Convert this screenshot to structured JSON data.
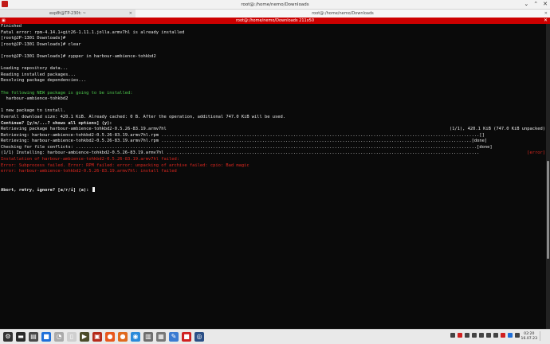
{
  "window": {
    "title": "root@:/home/nemo/Downloads"
  },
  "tabs": [
    {
      "label": "exp8t@TP-230t: ~"
    },
    {
      "label": "root@:/home/nemo/Downloads"
    }
  ],
  "terminal_title": "root@:/home/nemo/Downloads 211x50",
  "lines": [
    {
      "text": "Finished",
      "cls": ""
    },
    {
      "text": "Fatal error: rpm-4.14.1+git26-1.11.1.jolla.armv7hl is already installed",
      "cls": ""
    },
    {
      "text": "[root@JP-1301 Downloads]# ",
      "cls": ""
    },
    {
      "text": "[root@JP-1301 Downloads]# clear",
      "cls": ""
    },
    {
      "text": "",
      "cls": ""
    },
    {
      "text": "[root@JP-1301 Downloads]# zypper in harbour-ambience-tohkbd2",
      "cls": ""
    },
    {
      "text": "",
      "cls": ""
    },
    {
      "text": "Loading repository data...",
      "cls": ""
    },
    {
      "text": "Reading installed packages...",
      "cls": ""
    },
    {
      "text": "Resolving package dependencies...",
      "cls": ""
    },
    {
      "text": "",
      "cls": ""
    },
    {
      "text": "The following NEW package is going to be installed:",
      "cls": "g"
    },
    {
      "text": "  harbour-ambience-tohkbd2",
      "cls": ""
    },
    {
      "text": "",
      "cls": ""
    },
    {
      "text": "1 new package to install.",
      "cls": ""
    },
    {
      "text": "Overall download size: 420.1 KiB. Already cached: 0 B. After the operation, additional 747.0 KiB will be used.",
      "cls": ""
    },
    {
      "text": "Continue? [y/n/...? shows all options] (y): ",
      "cls": "b"
    },
    {
      "text": "Retrieving package harbour-ambience-tohkbd2-0.5.26-83.19.armv7hl",
      "cls": "",
      "right": "(1/1), 420.1 KiB (747.0 KiB unpacked)"
    },
    {
      "text": "Retrieving: harbour-ambience-tohkbd2-0.5.26-83.19.armv7hl.rpm ...........................................................................................................................[]",
      "cls": ""
    },
    {
      "text": "Retrieving: harbour-ambience-tohkbd2-0.5.26-83.19.armv7hl.rpm ........................................................................................................................[done]",
      "cls": ""
    },
    {
      "text": "Checking for file conflicts: ...........................................................................................................................................................[done]",
      "cls": ""
    },
    {
      "text": "(1/1) Installing: harbour-ambience-tohkbd2-0.5.26-83.19.armv7hl .........................................................................................................................",
      "cls": "",
      "right": "[error]",
      "rightcls": "r"
    },
    {
      "text": "Installation of harbour-ambience-tohkbd2-0.5.26-83.19.armv7hl failed:",
      "cls": "r"
    },
    {
      "text": "Error: Subprocess failed. Error: RPM failed: error: unpacking of archive failed: cpio: Bad magic",
      "cls": "r"
    },
    {
      "text": "error: harbour-ambience-tohkbd2-0.5.26-83.19.armv7hl: install failed",
      "cls": "r"
    },
    {
      "text": "",
      "cls": ""
    },
    {
      "text": "",
      "cls": ""
    },
    {
      "text": "Abort, retry, ignore? [a/r/i] (a): ",
      "cls": "b",
      "cursor": true
    }
  ],
  "scrollbar": {
    "thumb_position_fraction": 0.45,
    "thumb_size_fraction": 0.32
  },
  "taskbar": {
    "icons": [
      {
        "name": "app-launcher-icon",
        "color": "#333333",
        "glyph": "⚙"
      },
      {
        "name": "terminal-icon",
        "color": "#2a2a2a",
        "glyph": "▬"
      },
      {
        "name": "file-manager-icon",
        "color": "#4a4a4a",
        "glyph": "▤"
      },
      {
        "name": "blue-app-icon",
        "color": "#1e6fd9",
        "glyph": "■"
      },
      {
        "name": "clock-app-icon",
        "color": "#aaaaaa",
        "glyph": "◔"
      },
      {
        "name": "document-icon",
        "color": "#cfcfcf",
        "glyph": "▯"
      },
      {
        "name": "media-app-icon",
        "color": "#4b4b2a",
        "glyph": "▶"
      },
      {
        "name": "konsole-icon",
        "color": "#b52a1a",
        "glyph": "▣"
      },
      {
        "name": "firefox-icon",
        "color": "#e8571c",
        "glyph": "●"
      },
      {
        "name": "firefox-alt-icon",
        "color": "#e06a1e",
        "glyph": "●"
      },
      {
        "name": "globe-icon",
        "color": "#2a8ad9",
        "glyph": "◉"
      },
      {
        "name": "folder-icon",
        "color": "#6e6e6e",
        "glyph": "▥"
      },
      {
        "name": "printer-icon",
        "color": "#777777",
        "glyph": "▦"
      },
      {
        "name": "edit-icon",
        "color": "#3b7bd1",
        "glyph": "✎"
      },
      {
        "name": "red-app-icon",
        "color": "#d02020",
        "glyph": "■"
      },
      {
        "name": "steam-icon",
        "color": "#2b4f86",
        "glyph": "◎"
      }
    ],
    "tray_colors": [
      "#444444",
      "#d02020",
      "#444444",
      "#444444",
      "#444444",
      "#444444",
      "#444444",
      "#d02020",
      "#1e6fd9",
      "#444444"
    ],
    "clock_time": "02:20",
    "clock_date": "16.07.23"
  }
}
